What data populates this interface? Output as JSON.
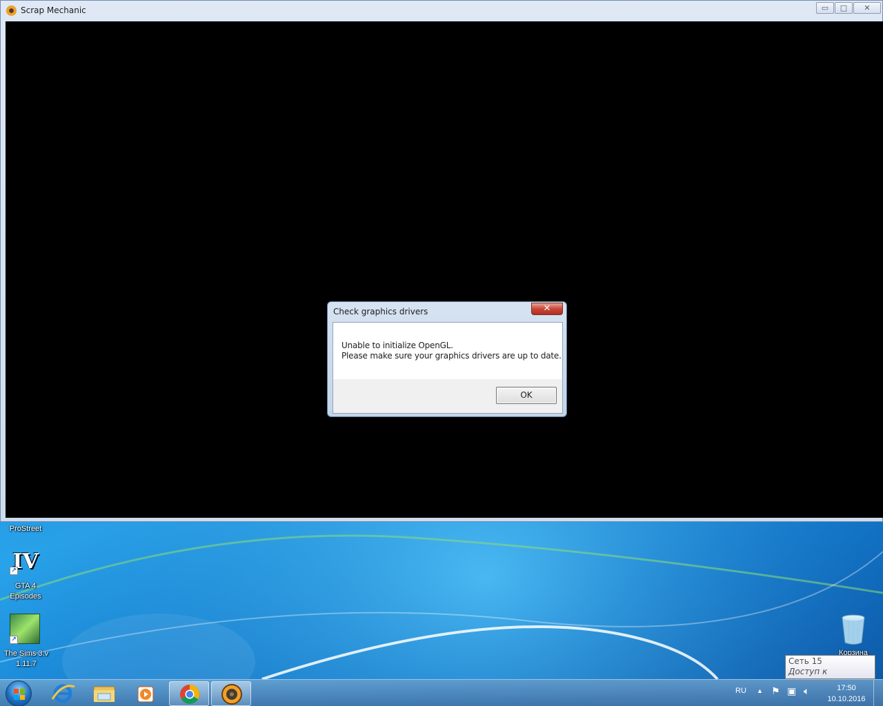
{
  "app_window": {
    "title": "Scrap Mechanic",
    "controls": {
      "minimize": "▭",
      "maximize": "□",
      "close": "✕"
    }
  },
  "dialog": {
    "title": "Check graphics drivers",
    "close_glyph": "✕",
    "message_line1": "Unable to initialize OpenGL.",
    "message_line2": "Please make sure your graphics drivers are up to date.",
    "ok_label": "OK"
  },
  "desktop_icons": [
    {
      "label": "ProStreet"
    },
    {
      "label_line1": "GTA 4",
      "label_line2": "Episodes",
      "badge": "IV"
    },
    {
      "label_line1": "The Sims 3.v",
      "label_line2": "1.11.7"
    },
    {
      "label": "Корзина"
    }
  ],
  "tooltip": {
    "line1": "Сеть  15",
    "line2": "Доступ к Интернету"
  },
  "taskbar": {
    "pinned": [
      {
        "icon": "internet-explorer-icon"
      },
      {
        "icon": "explorer-folder-icon"
      },
      {
        "icon": "media-player-icon"
      },
      {
        "icon": "chrome-icon"
      },
      {
        "icon": "scrap-mechanic-icon"
      }
    ],
    "tray": {
      "language": "RU",
      "time": "17:50",
      "date": "10.10.2016"
    }
  },
  "colors": {
    "dialog_close_red": "#c8473a",
    "canvas": "#000000"
  }
}
